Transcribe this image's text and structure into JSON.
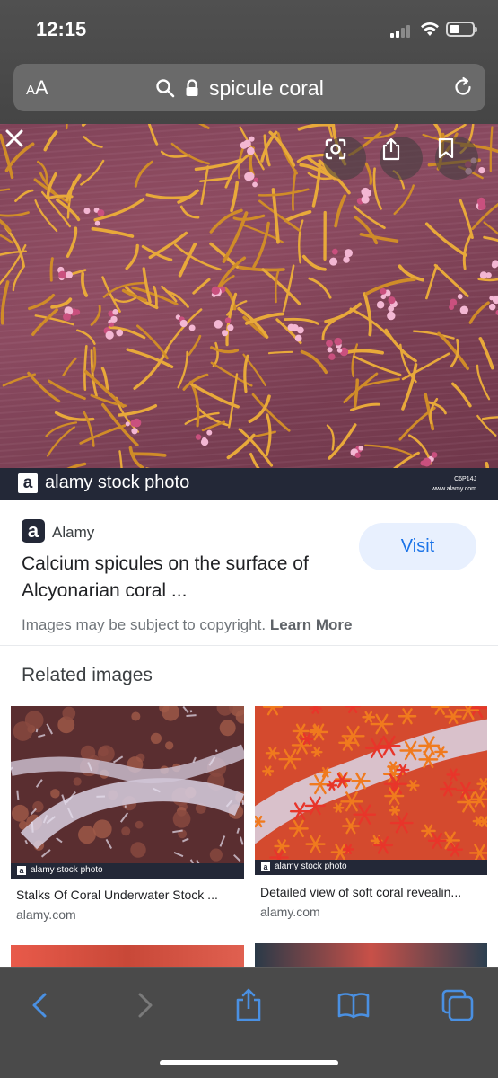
{
  "status_bar": {
    "time": "12:15"
  },
  "address_bar": {
    "text_size_label_small": "A",
    "text_size_label_large": "A",
    "url": "spicule coral"
  },
  "main_image": {
    "watermark_text": "alamy stock photo",
    "watermark_logo": "a",
    "image_id": "C6P14J",
    "image_site": "www.alamy.com"
  },
  "result": {
    "source_logo": "a",
    "source_name": "Alamy",
    "visit_label": "Visit",
    "title": "Calcium spicules on the surface of Alcyonarian coral ...",
    "copyright_text": "Images may be subject to copyright.",
    "learn_more": "Learn More"
  },
  "related": {
    "heading": "Related images",
    "items": [
      {
        "title": "Stalks Of Coral Underwater Stock ...",
        "domain": "alamy.com",
        "watermark": "alamy stock photo"
      },
      {
        "title": "Detailed view of soft coral revealin...",
        "domain": "alamy.com",
        "watermark": "alamy stock photo"
      }
    ]
  },
  "icons": {
    "back": "chevron-left-icon",
    "forward": "chevron-right-icon",
    "share": "share-icon",
    "bookmarks": "book-icon",
    "tabs": "tabs-icon",
    "lens": "lens-icon",
    "save": "bookmark-icon",
    "close": "close-icon"
  },
  "colors": {
    "accent": "#1a73e8",
    "visit_bg": "#e8f0fe",
    "ios_blue": "#4a90e2",
    "chrome_bg": "#4a4a4a"
  }
}
